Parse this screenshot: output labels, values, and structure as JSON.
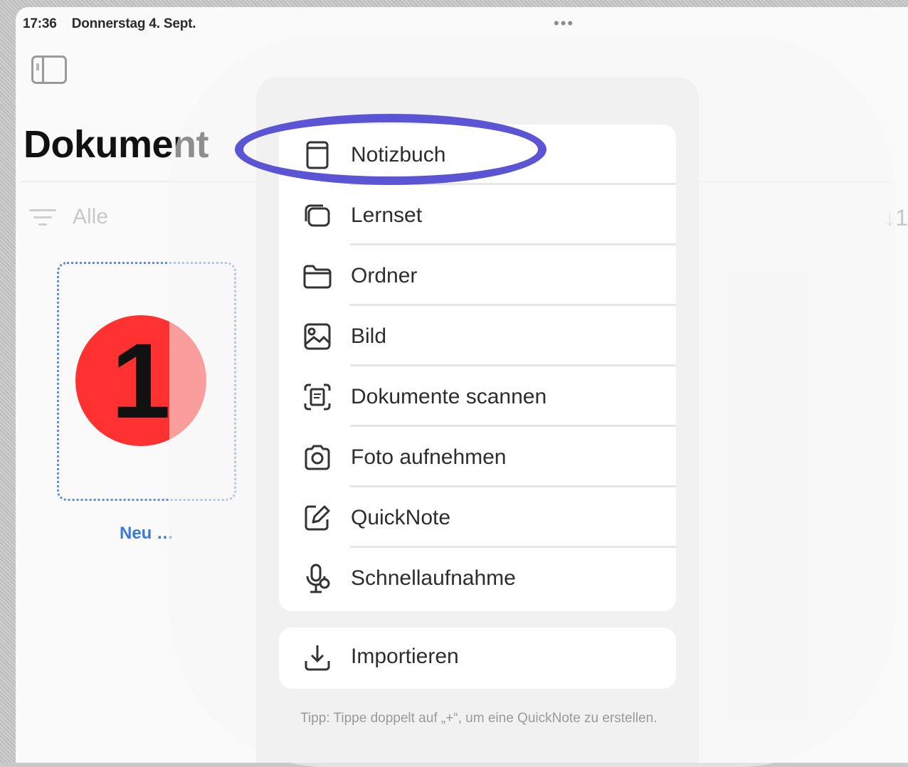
{
  "status_bar": {
    "time": "17:36",
    "date": "Donnerstag 4. Sept.",
    "more": "•••"
  },
  "header": {
    "title": "Dokument"
  },
  "filter": {
    "label": "Alle",
    "sort_symbol": "↓1"
  },
  "new_tile": {
    "label": "Neu …",
    "step_badge": "1"
  },
  "menu": {
    "items": [
      {
        "label": "Notizbuch",
        "icon": "notebook-icon"
      },
      {
        "label": "Lernset",
        "icon": "stack-icon"
      },
      {
        "label": "Ordner",
        "icon": "folder-icon"
      },
      {
        "label": "Bild",
        "icon": "image-icon"
      },
      {
        "label": "Dokumente scannen",
        "icon": "scan-icon"
      },
      {
        "label": "Foto aufnehmen",
        "icon": "camera-icon"
      },
      {
        "label": "QuickNote",
        "icon": "edit-icon"
      },
      {
        "label": "Schnellaufnahme",
        "icon": "microphone-icon"
      }
    ],
    "import_label": "Importieren",
    "tip": "Tipp: Tippe doppelt auf „+“, um eine QuickNote zu erstellen."
  },
  "colors": {
    "highlight": "#5b55d6",
    "badge": "#ff3131",
    "accent": "#3a7bd5"
  }
}
